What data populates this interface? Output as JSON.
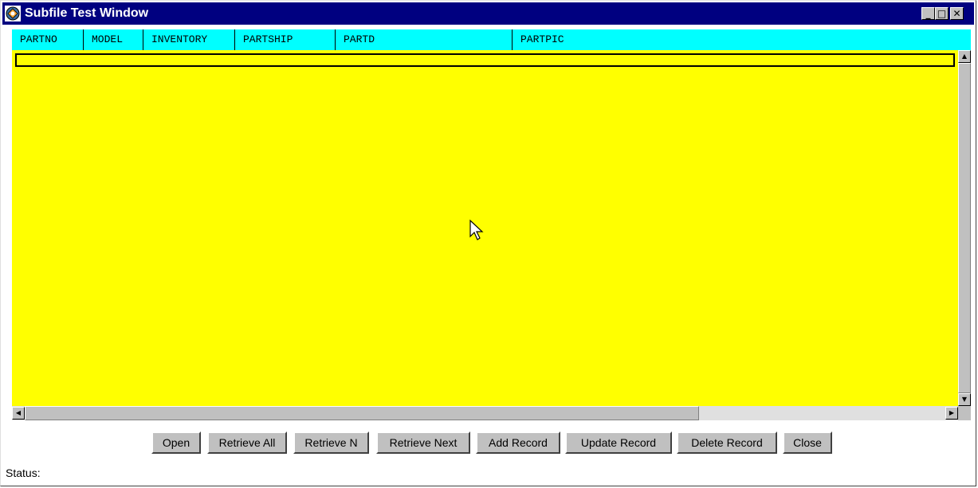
{
  "window": {
    "title": "Subfile Test Window",
    "controls": {
      "minimize": "_",
      "maximize": "□",
      "close": "✕"
    }
  },
  "columns": [
    "PARTNO",
    "MODEL",
    "INVENTORY",
    "PARTSHIP",
    "PARTD",
    "PARTPIC"
  ],
  "buttons": {
    "open": "Open",
    "retrieve_all": "Retrieve All",
    "retrieve_n": "Retrieve N",
    "retrieve_next": "Retrieve Next",
    "add_record": "Add Record",
    "update_record": "Update Record",
    "delete_record": "Delete Record",
    "close": "Close"
  },
  "status": {
    "label": "Status:"
  },
  "colors": {
    "titlebar": "#000080",
    "header": "#00ffff",
    "grid": "#ffff00",
    "chrome": "#c0c0c0"
  }
}
